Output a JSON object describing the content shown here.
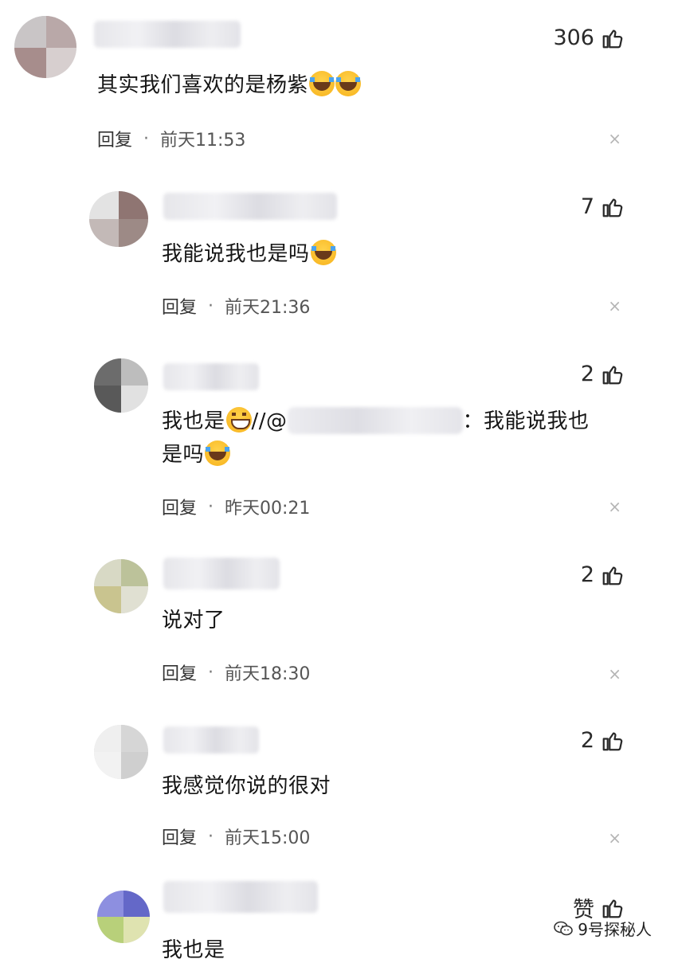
{
  "comments": [
    {
      "likes": "306",
      "text_before": "其实我们喜欢的是杨紫",
      "emoji": [
        "cry",
        "cry"
      ],
      "reply_label": "回复",
      "time": "前天11:53",
      "close": "×"
    },
    {
      "likes": "7",
      "text_before": "我能说我也是吗",
      "emoji": [
        "cry"
      ],
      "reply_label": "回复",
      "time": "前天21:36",
      "close": "×"
    },
    {
      "likes": "2",
      "text_part1": "我也是",
      "text_part2": "//@",
      "text_part3": "：我能说我也",
      "text_part4": "是吗",
      "reply_label": "回复",
      "time": "昨天00:21",
      "close": "×"
    },
    {
      "likes": "2",
      "text_before": "说对了",
      "reply_label": "回复",
      "time": "前天18:30",
      "close": "×"
    },
    {
      "likes": "2",
      "text_before": "我感觉你说的很对",
      "reply_label": "回复",
      "time": "前天15:00",
      "close": "×"
    },
    {
      "likes": "赞",
      "text_before": "我也是"
    }
  ],
  "watermark": {
    "text": "9号探秘人",
    "icon": "wechat-icon"
  },
  "icons": {
    "like": "thumbs-up-icon",
    "close": "close-icon"
  }
}
